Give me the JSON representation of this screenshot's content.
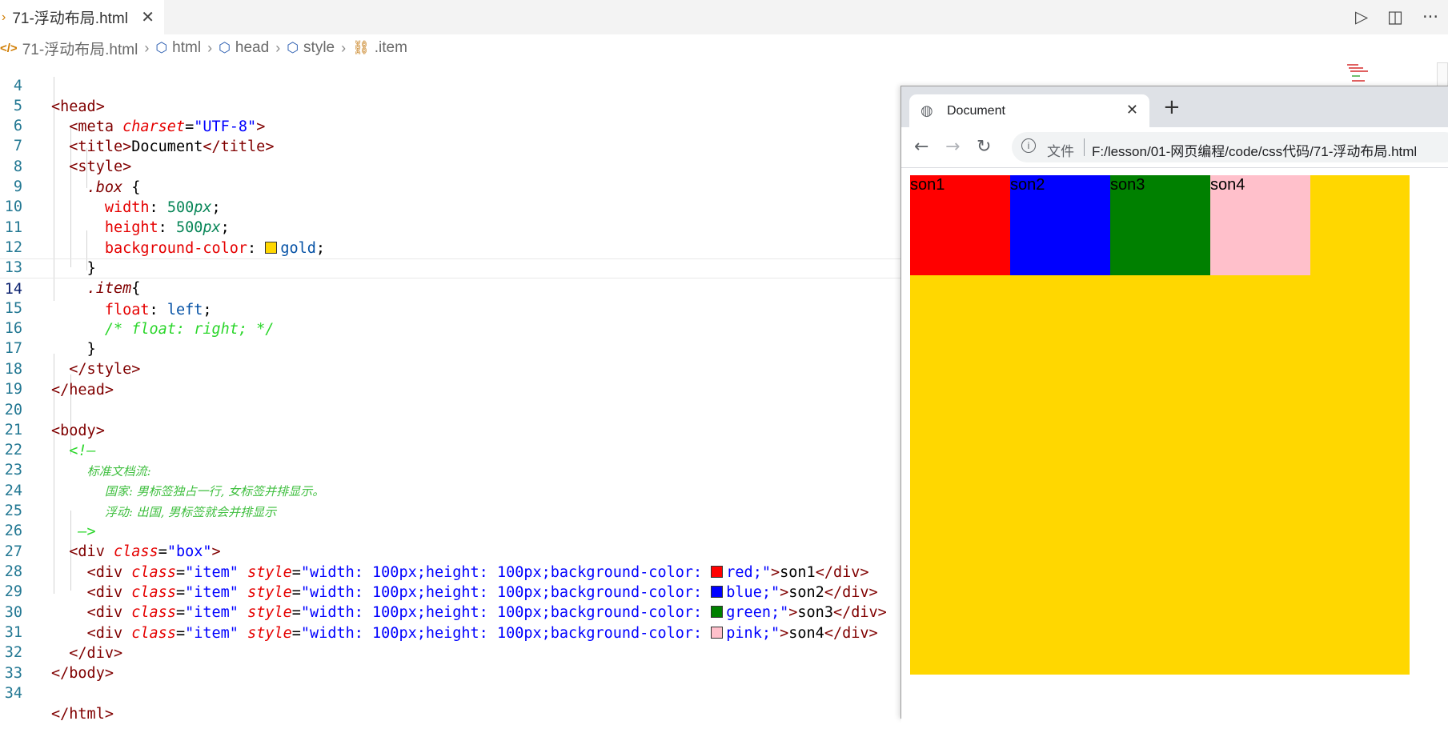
{
  "editor": {
    "tab_label": "71-浮动布局.html",
    "tab_close": "✕",
    "top_icons": [
      "run-icon",
      "split-editor-icon",
      "more-icon"
    ],
    "top_icon_glyphs": [
      "▷",
      "◫",
      "···"
    ],
    "breadcrumb": [
      "71-浮动布局.html",
      "html",
      "head",
      "style",
      ".item"
    ],
    "line_numbers": [
      "4",
      "5",
      "6",
      "7",
      "8",
      "9",
      "10",
      "11",
      "12",
      "13",
      "14",
      "15",
      "16",
      "17",
      "18",
      "19",
      "20",
      "21",
      "22",
      "23",
      "24",
      "25",
      "26",
      "27",
      "28",
      "29",
      "30",
      "31",
      "32",
      "33",
      "34"
    ],
    "current_line": "14"
  },
  "code": {
    "l4": "<head>",
    "l5_tag_open": "<meta ",
    "l5_attr": "charset",
    "l5_eq": "=",
    "l5_str": "\"UTF-8\"",
    "l5_close": ">",
    "l6_open": "<title>",
    "l6_text": "Document",
    "l6_close": "</title>",
    "l7": "<style>",
    "l8_sel": ".box",
    "l8_brace": " {",
    "l9_prop": "width",
    "l9_num": "500",
    "l9_unit": "px",
    "l10_prop": "height",
    "l10_num": "500",
    "l10_unit": "px",
    "l11_prop": "background-color",
    "l11_val": "gold",
    "l12": "}",
    "l13_sel": ".item",
    "l13_brace": "{",
    "l14_prop": "float",
    "l14_val": "left",
    "l15": "/* float: right; */",
    "l16": "}",
    "l17": "</style>",
    "l18": "</head>",
    "l20": "<body>",
    "l21": "<!—",
    "l22": "标准文档流:",
    "l23": "国家: 男标签独占一行, 女标签并排显示。",
    "l24": "浮动: 出国, 男标签就会并排显示",
    "l25": "—>",
    "l26_open": "<div ",
    "l26_attr": "class",
    "l26_str": "\"box\"",
    "l26_close": ">",
    "div_open": "<div ",
    "class_attr": "class",
    "class_str": "\"item\"",
    "style_attr": "style",
    "style_prefix": "\"width: 100px;height: 100px;background-color: ",
    "rows": [
      {
        "color": "red",
        "text": "son1",
        "hex": "#ff0000"
      },
      {
        "color": "blue",
        "text": "son2",
        "hex": "#0000ff"
      },
      {
        "color": "green",
        "text": "son3",
        "hex": "#008000"
      },
      {
        "color": "pink",
        "text": "son4",
        "hex": "#ffc0cb"
      }
    ],
    "l31": "</div>",
    "l32": "</body>",
    "l34": "</html>"
  },
  "browser": {
    "tab_title": "Document",
    "new_tab": "+",
    "back": "←",
    "forward": "→",
    "reload": "↻",
    "file_label": "文件",
    "url": "F:/lesson/01-网页编程/code/css代码/71-浮动布局.html",
    "box_color": "#ffd700",
    "items": [
      {
        "label": "son1",
        "color": "#ff0000"
      },
      {
        "label": "son2",
        "color": "#0000ff"
      },
      {
        "label": "son3",
        "color": "#008000"
      },
      {
        "label": "son4",
        "color": "#ffc0cb"
      }
    ]
  }
}
